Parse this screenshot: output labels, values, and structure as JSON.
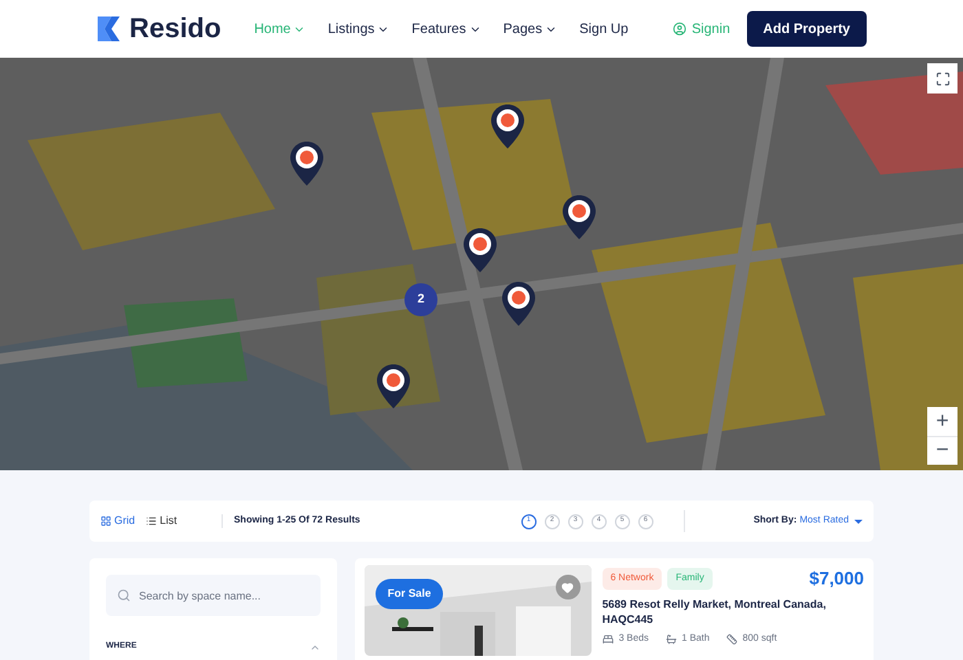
{
  "header": {
    "logo": "Resido",
    "nav": [
      {
        "label": "Home",
        "selected": true,
        "dropdown": true
      },
      {
        "label": "Listings",
        "selected": false,
        "dropdown": true
      },
      {
        "label": "Features",
        "selected": false,
        "dropdown": true
      },
      {
        "label": "Pages",
        "selected": false,
        "dropdown": true
      },
      {
        "label": "Sign Up",
        "selected": false,
        "dropdown": false
      }
    ],
    "signin": "Signin",
    "cta": "Add Property"
  },
  "map": {
    "cluster": "2",
    "zoom_in": "+",
    "zoom_out": "−"
  },
  "toolbar": {
    "views": [
      {
        "label": "Grid",
        "selected": true
      },
      {
        "label": "List",
        "selected": false
      }
    ],
    "summary": "Showing 1-25 Of 72 Results",
    "pages": [
      {
        "label": "1",
        "selected": true
      },
      {
        "label": "2",
        "selected": false
      },
      {
        "label": "3",
        "selected": false
      },
      {
        "label": "4",
        "selected": false
      },
      {
        "label": "5",
        "selected": false
      },
      {
        "label": "6",
        "selected": false
      }
    ],
    "sort_label": "Short By:",
    "sort_value": "Most Rated"
  },
  "sidebar": {
    "search": {
      "placeholder": "Search by space name..."
    },
    "section": "WHERE"
  },
  "listing": {
    "status": "For Sale",
    "favorite": false,
    "tags": [
      {
        "label": "6 Network",
        "color": "#f05a3a"
      },
      {
        "label": "Family",
        "color": "#27b576"
      }
    ],
    "price": "$7,000",
    "title": "5689 Resot Relly Market, Montreal Canada, HAQC445",
    "facts": [
      "3 Beds",
      "1 Bath",
      "800 sqft"
    ]
  }
}
